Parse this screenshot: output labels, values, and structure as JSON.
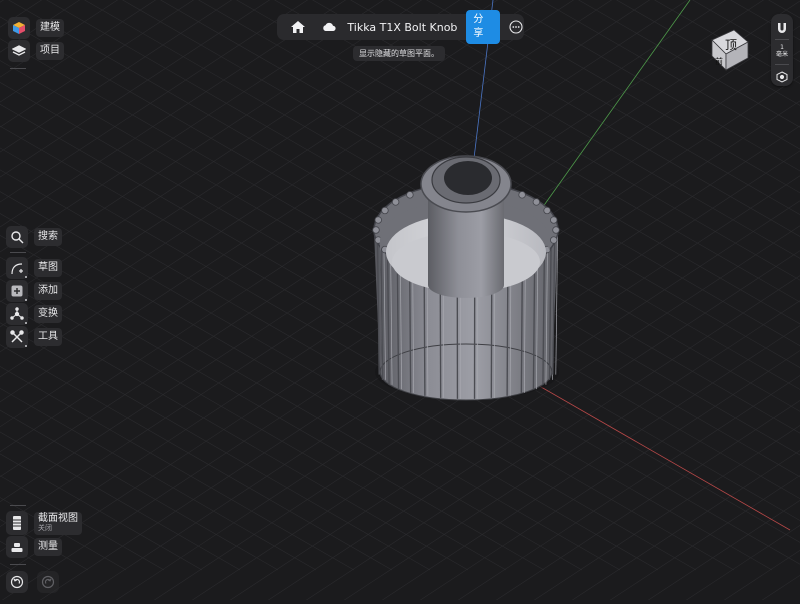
{
  "left_toolbar": {
    "top_items": [
      {
        "label": "建模",
        "icon": "model-workspace-icon"
      },
      {
        "label": "项目",
        "icon": "layers-icon"
      }
    ],
    "tools": [
      {
        "label": "搜索",
        "icon": "search-icon"
      },
      {
        "label": "草图",
        "icon": "sketch-icon"
      },
      {
        "label": "添加",
        "icon": "add-icon"
      },
      {
        "label": "变换",
        "icon": "transform-icon"
      },
      {
        "label": "工具",
        "icon": "tools-icon"
      }
    ],
    "bottom_items": [
      {
        "label": "截面视图",
        "sublabel": "关闭",
        "icon": "section-view-icon"
      },
      {
        "label": "测量",
        "icon": "measure-icon"
      }
    ],
    "history": [
      {
        "icon": "undo-icon"
      },
      {
        "icon": "redo-icon"
      }
    ]
  },
  "title_bar": {
    "home_icon": "home-icon",
    "cloud_icon": "cloud-icon",
    "title": "Tikka T1X Bolt Knob",
    "share_label": "分享",
    "more_icon": "more-icon"
  },
  "tooltip": "显示隐藏的草图平面。",
  "view_cube": {
    "top_label": "顶",
    "front_label": "前"
  },
  "right_panel": {
    "magnet_icon": "magnet-snap-icon",
    "unit_value": "1",
    "unit_label": "毫米",
    "view_settings_icon": "view-settings-icon"
  },
  "colors": {
    "background": "#1b1b1d",
    "panel": "#2c2c2f",
    "accent": "#1e8ce4",
    "axis_x": "#b84848",
    "axis_y": "#4e9a4a",
    "axis_z": "#4b76c6",
    "model": "#8d8e96"
  }
}
